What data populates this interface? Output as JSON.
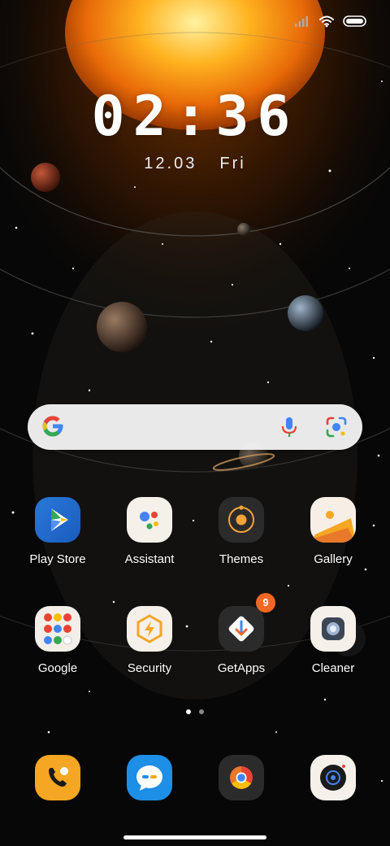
{
  "status_bar": {
    "signal_icon": "cellular-signal-icon",
    "wifi_icon": "wifi-icon",
    "battery_icon": "battery-icon"
  },
  "lockclock": {
    "time": "02:36",
    "date": "12.03",
    "weekday": "Fri"
  },
  "search_bar": {
    "logo_icon": "google-g-icon",
    "mic_icon": "microphone-icon",
    "lens_icon": "google-lens-icon"
  },
  "apps_row1": [
    {
      "label": "Play Store",
      "icon": "play-store-icon"
    },
    {
      "label": "Assistant",
      "icon": "assistant-icon"
    },
    {
      "label": "Themes",
      "icon": "themes-icon"
    },
    {
      "label": "Gallery",
      "icon": "gallery-icon"
    }
  ],
  "apps_row2": [
    {
      "label": "Google",
      "icon": "google-folder-icon"
    },
    {
      "label": "Security",
      "icon": "security-icon"
    },
    {
      "label": "GetApps",
      "icon": "getapps-icon",
      "badge": "9"
    },
    {
      "label": "Cleaner",
      "icon": "cleaner-icon"
    }
  ],
  "dock": [
    {
      "icon": "phone-icon"
    },
    {
      "icon": "messages-icon"
    },
    {
      "icon": "chrome-icon"
    },
    {
      "icon": "camera-icon"
    }
  ],
  "page_indicator": {
    "count": 2,
    "active": 1
  },
  "colors": {
    "badge": "#f26722",
    "accent_orange": "#f5a623",
    "search_bg": "#f2f2f2"
  }
}
